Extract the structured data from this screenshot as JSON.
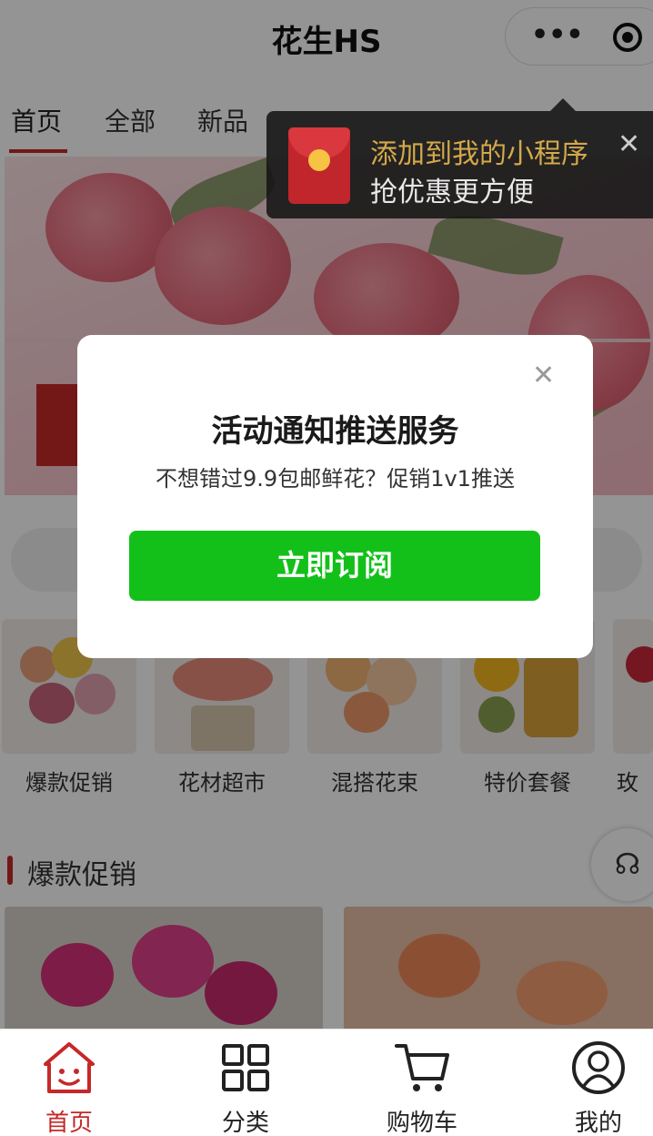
{
  "app": {
    "title": "花生HS"
  },
  "tabs": [
    {
      "label": "首页",
      "active": true
    },
    {
      "label": "全部",
      "active": false
    },
    {
      "label": "新品",
      "active": false
    }
  ],
  "capsule": {
    "more_icon": "more-dots-icon",
    "close_icon": "target-close-icon"
  },
  "tooltip": {
    "line1": "添加到我的小程序",
    "line2": "抢优惠更方便",
    "close": "✕"
  },
  "dialog": {
    "close": "✕",
    "title": "活动通知推送服务",
    "description": "不想错过9.9包邮鲜花？促销1v1推送",
    "button": "立即订阅"
  },
  "categories": [
    {
      "label": "爆款促销"
    },
    {
      "label": "花材超市"
    },
    {
      "label": "混搭花束"
    },
    {
      "label": "特价套餐"
    },
    {
      "label": "玫"
    }
  ],
  "section": {
    "title": "爆款促销"
  },
  "bottom_nav": [
    {
      "label": "首页",
      "icon": "home-icon",
      "active": true
    },
    {
      "label": "分类",
      "icon": "grid-icon",
      "active": false
    },
    {
      "label": "购物车",
      "icon": "cart-icon",
      "active": false
    },
    {
      "label": "我的",
      "icon": "user-icon",
      "active": false
    }
  ],
  "colors": {
    "accent": "#c62828",
    "subscribe_button": "#13c01a",
    "tooltip_highlight": "#d4a94a"
  }
}
